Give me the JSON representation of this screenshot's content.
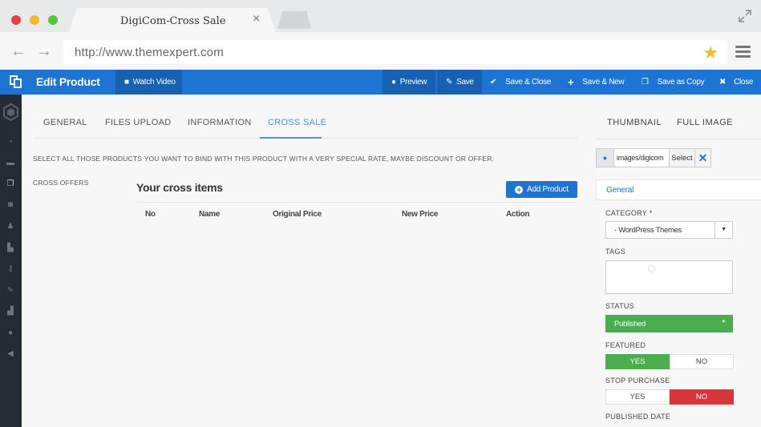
{
  "browser": {
    "tab_title": "DigiCom-Cross Sale",
    "tab_close": "×",
    "back": "←",
    "forward": "→",
    "url": "http://www.themexpert.com",
    "star": "★"
  },
  "header": {
    "title": "Edit Product",
    "watch_video": "Watch Video",
    "preview": "Preview",
    "save": "Save",
    "save_close": "Save & Close",
    "save_new": "Save & New",
    "save_copy": "Save as Copy",
    "close": "Close"
  },
  "tabs": [
    "GENERAL",
    "FILES UPLOAD",
    "INFORMATION",
    "CROSS SALE"
  ],
  "main": {
    "instruction": "SELECT ALL THOSE PRODUCTS YOU WANT TO BIND WITH THIS PRODUCT WITH A VERY SPECIAL RATE, MAYBE DISCOUNT OR OFFER.",
    "cross_offers_label": "CROSS OFFERS",
    "cross_title": "Your cross items",
    "add_product": "Add Product",
    "columns": [
      "No",
      "Name",
      "Original Price",
      "New Price",
      "Action"
    ]
  },
  "right": {
    "tabs": [
      "THUMBNAIL",
      "FULL IMAGE"
    ],
    "image_path": "images/digicom",
    "image_select": "Select",
    "general_tab": "General",
    "category_label": "CATEGORY *",
    "category_value": "- WordPress Themes",
    "tags_label": "TAGS",
    "status_label": "STATUS",
    "status_value": "Published",
    "featured_label": "FEATURED",
    "featured_yes": "YES",
    "featured_no": "NO",
    "stop_purchase_label": "STOP PURCHASE",
    "stop_yes": "YES",
    "stop_no": "NO",
    "published_date_label": "PUBLISHED DATE"
  },
  "colors": {
    "brand_blue": "#1d74d2",
    "active_tab": "#4a94d6",
    "green": "#4aad4e",
    "red": "#d6353a"
  }
}
